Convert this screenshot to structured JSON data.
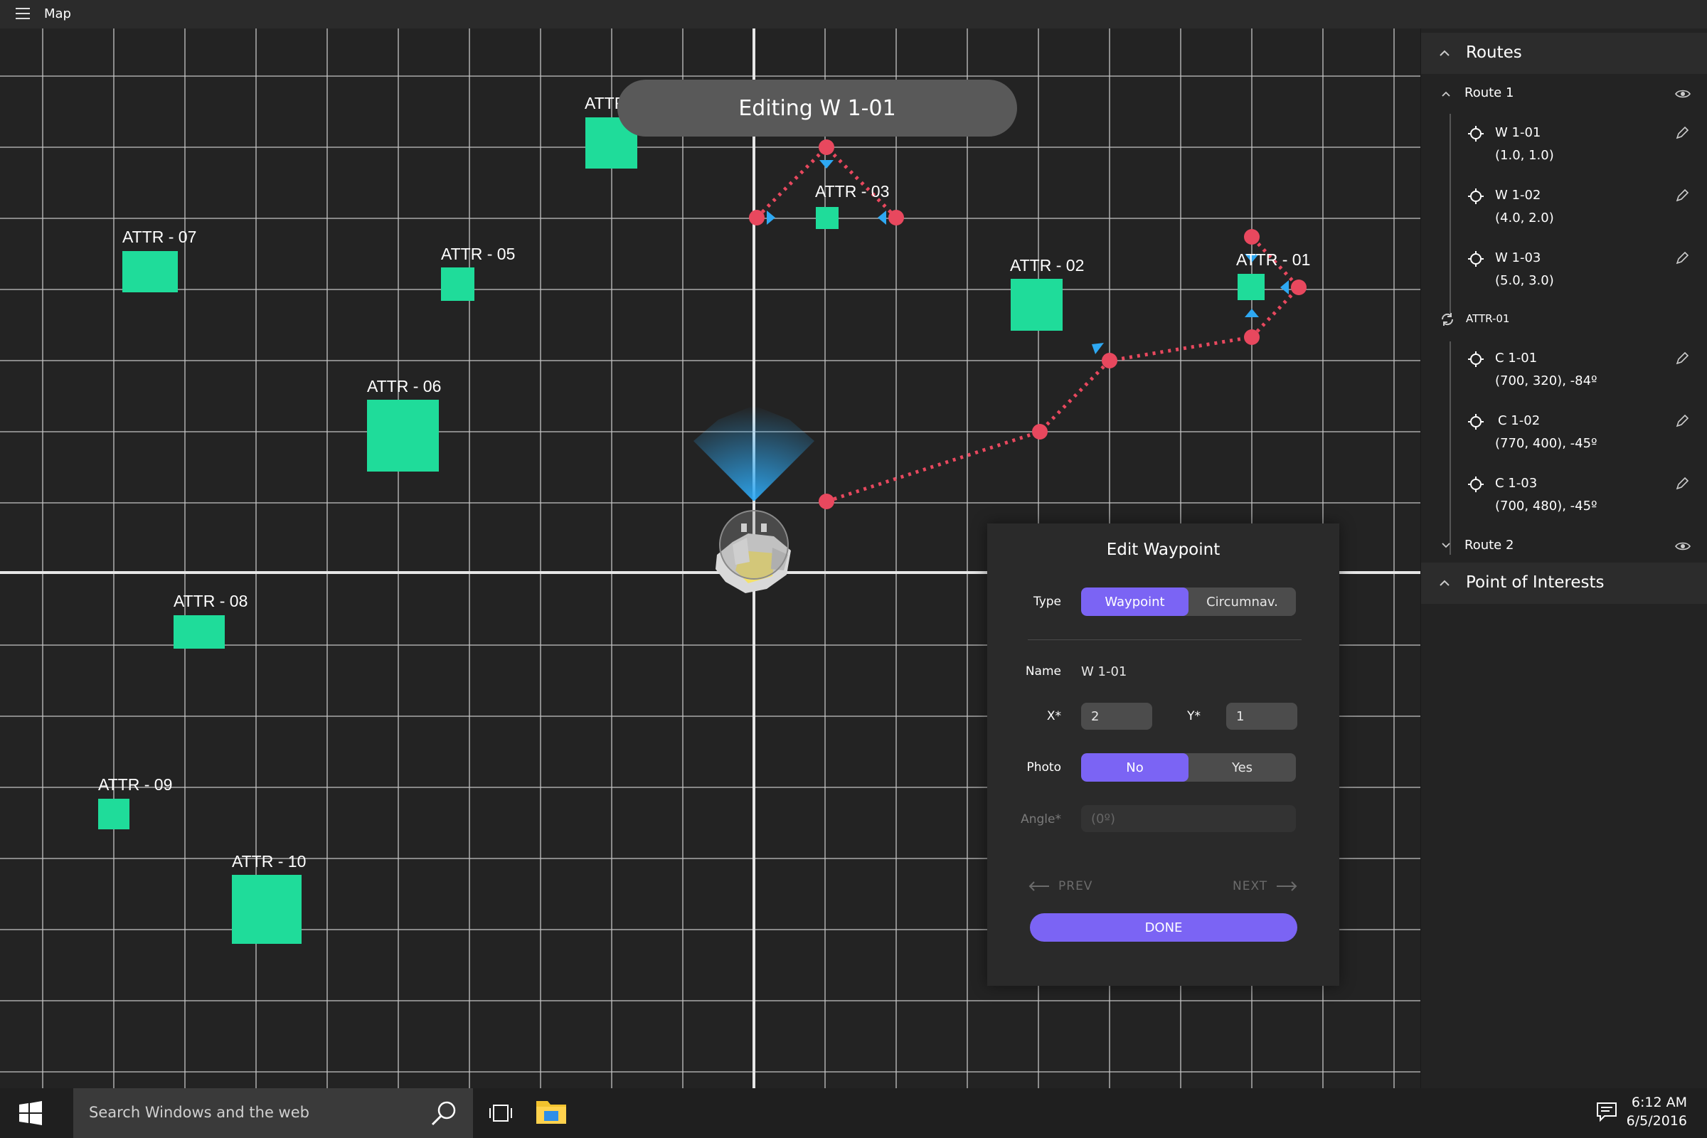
{
  "app": {
    "title": "Map"
  },
  "banner": {
    "text": "Editing W 1-01"
  },
  "map": {
    "attractions": [
      {
        "label": "ATTR - 01"
      },
      {
        "label": "ATTR - 02"
      },
      {
        "label": "ATTR - 03"
      },
      {
        "label": "ATTR"
      },
      {
        "label": "ATTR - 05"
      },
      {
        "label": "ATTR - 06"
      },
      {
        "label": "ATTR - 07"
      },
      {
        "label": "ATTR - 08"
      },
      {
        "label": "ATTR - 09"
      },
      {
        "label": "ATTR - 10"
      }
    ]
  },
  "edit_panel": {
    "title": "Edit Waypoint",
    "type_label": "Type",
    "type_options": [
      "Waypoint",
      "Circumnav."
    ],
    "type_selected": "Waypoint",
    "name_label": "Name",
    "name_value": "W 1-01",
    "x_label": "X*",
    "x_value": "2",
    "y_label": "Y*",
    "y_value": "1",
    "photo_label": "Photo",
    "photo_options": [
      "No",
      "Yes"
    ],
    "photo_selected": "No",
    "angle_label": "Angle*",
    "angle_placeholder": "(0º)",
    "prev_label": "PREV",
    "next_label": "NEXT",
    "done_label": "DONE"
  },
  "sidebar": {
    "routes_header": "Routes",
    "route1": {
      "label": "Route 1",
      "waypoints": [
        {
          "name": "W 1-01",
          "coord": "(1.0, 1.0)"
        },
        {
          "name": "W 1-02",
          "coord": "(4.0, 2.0)"
        },
        {
          "name": "W 1-03",
          "coord": "(5.0, 3.0)"
        }
      ],
      "circumnav_label": "ATTR-01",
      "circumnav_points": [
        {
          "name": "C 1-01",
          "coord": "(700, 320), -84º"
        },
        {
          "name": "C 1-02",
          "coord": "(770, 400), -45º"
        },
        {
          "name": "C 1-03",
          "coord": "(700, 480), -45º"
        }
      ]
    },
    "route2": {
      "label": "Route 2"
    },
    "poi_header": "Point of Interests"
  },
  "taskbar": {
    "search_placeholder": "Search Windows and the web",
    "time": "6:12 AM",
    "date": "6/5/2016"
  },
  "colors": {
    "accent": "#7b64f4",
    "attraction": "#1fdc9a",
    "route": "#e8485e",
    "marker": "#2ea8f2",
    "grid": "#dcdcdc"
  },
  "icons": [
    "hamburger-icon",
    "chevron-up-icon",
    "chevron-down-icon",
    "eye-icon",
    "pencil-icon",
    "target-icon",
    "loop-icon",
    "arrow-left-icon",
    "arrow-right-icon",
    "windows-logo-icon",
    "search-icon",
    "task-view-icon",
    "file-explorer-icon",
    "notification-icon",
    "drone-icon"
  ]
}
